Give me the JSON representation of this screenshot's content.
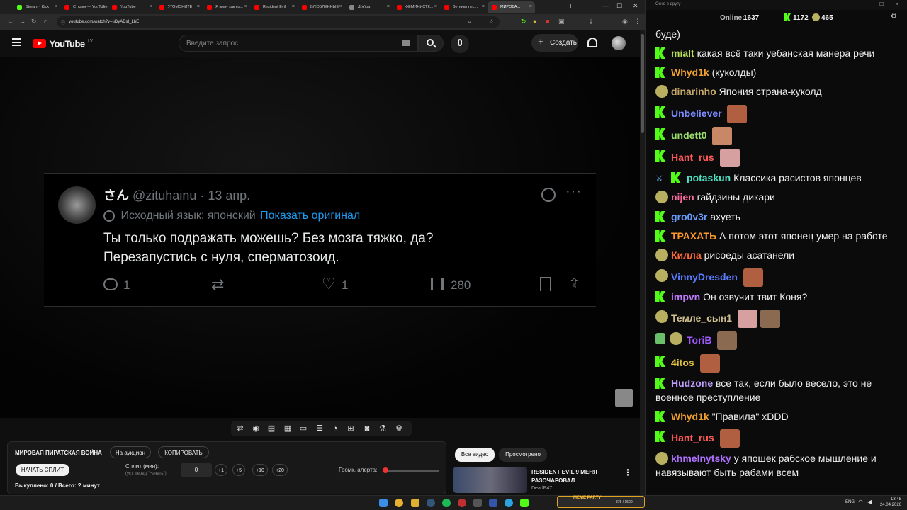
{
  "browser": {
    "tabs": [
      {
        "label": "Stream - Kick",
        "color": "#53fc18"
      },
      {
        "label": "Студия — YouTube",
        "color": "#ff0000"
      },
      {
        "label": "YouTube",
        "color": "#ff0000"
      },
      {
        "label": "УГОМОНИТЕ",
        "color": "#ff0000"
      },
      {
        "label": "Я живу как ко...",
        "color": "#ff0000"
      },
      {
        "label": "Resident Evil",
        "color": "#ff0000"
      },
      {
        "label": "ВЛЮБЛЕННЫЕ",
        "color": "#ff0000"
      },
      {
        "label": "Д(ж)ра",
        "color": "#888888"
      },
      {
        "label": "ФЕМИНИСТК...",
        "color": "#ff0000"
      },
      {
        "label": "Зетники пес...",
        "color": "#ff0000"
      },
      {
        "label": "МИРОВА...",
        "color": "#ff0000"
      }
    ],
    "url": "youtube.com/watch?v=uDyADsI_LhE"
  },
  "youtube": {
    "logo": "YouTube",
    "region": "LV",
    "search_placeholder": "Введите запрос",
    "create_label": "Создать"
  },
  "tweet": {
    "name": "さん",
    "handle": "@zituhainu · 13 апр.",
    "translated_from": "Исходный язык: японский",
    "show_original": "Показать оригинал",
    "line1": "Ты только подражать можешь? Без мозга тяжко, да?",
    "line2": "Перезапустись с нуля, сперматозоид.",
    "replies": "1",
    "likes": "1",
    "views": "280"
  },
  "ext_panel": {
    "title": "МИРОВАЯ ПИРАТСКАЯ ВОЙНА",
    "on_auction": "На аукцион",
    "copy": "КОПИРОВАТЬ",
    "start_split": "НАЧАТЬ СПЛИТ",
    "split_label": "Сплит (мин):",
    "split_hint": "(уст. перед \"Начать\")",
    "split_value": "0",
    "inc": [
      "+1",
      "+5",
      "+10",
      "+20"
    ],
    "alert_volume": "Громк. алерта:",
    "alert_volume_level": 0.05,
    "bought": "Выкуплено: 0 / Всего: ? минут"
  },
  "suggestions": {
    "tab_all": "Все видео",
    "tab_watched": "Просмотрено",
    "video_title_1": "RESIDENT EVIL 9 МЕНЯ",
    "video_title_2": "РАЗОЧАРОВАЛ",
    "channel": "DeadP47"
  },
  "chat": {
    "window_title": "Окно в другу",
    "online_label": "Online:",
    "online": "1637",
    "kick_count": "1172",
    "other_count": "465",
    "messages": [
      {
        "user": "",
        "text": "буде)",
        "color": "#efefef"
      },
      {
        "user": "mialt",
        "text": "какая всё таки уебанская манера речи",
        "color": "#b8e05c"
      },
      {
        "user": "Whyd1k",
        "text": "(куколды)",
        "color": "#f0a030"
      },
      {
        "user": "dinarinho",
        "text": "Япония страна-куколд",
        "color": "#c6a86a"
      },
      {
        "user": "Unbeliever",
        "text": "",
        "color": "#7a8cff"
      },
      {
        "user": "undett0",
        "text": "",
        "color": "#9be06c"
      },
      {
        "user": "Hant_rus",
        "text": "",
        "color": "#ff5a5a"
      },
      {
        "user": "potaskun",
        "text": "Классика расистов японцев",
        "color": "#4ee0c0"
      },
      {
        "user": "nijen",
        "text": "гайдзины дикари",
        "color": "#ff6aa0"
      },
      {
        "user": "gro0v3r",
        "text": "ахуеть",
        "color": "#6a9cff"
      },
      {
        "user": "ТРАХАТЬ",
        "text": "А потом этот японец умер на работе",
        "color": "#ff9a2a"
      },
      {
        "user": "Килла",
        "text": "рисоеды асатанели",
        "color": "#ff6a3a"
      },
      {
        "user": "VinnyDresden",
        "text": "",
        "color": "#5a7cff"
      },
      {
        "user": "impvn",
        "text": "Он озвучит твит Коня?",
        "color": "#c07aff"
      },
      {
        "user": "Темле_сын1",
        "text": "",
        "color": "#d0c090"
      },
      {
        "user": "ToriB",
        "text": "",
        "color": "#a05aff"
      },
      {
        "user": "4itos",
        "text": "",
        "color": "#e0c040"
      },
      {
        "user": "Hudzone",
        "text": "все так, если было весело, это не",
        "color": "#c0a0ff"
      },
      {
        "user": "",
        "text": "военное преступление",
        "color": "#efefef"
      },
      {
        "user": "Whyd1k",
        "text": "\"Правила\" xDDD",
        "color": "#f0a030"
      },
      {
        "user": "Hant_rus",
        "text": "",
        "color": "#ff5a5a"
      },
      {
        "user": "khmelnytsky",
        "text": "у япошек рабское мышление и",
        "color": "#b070ff"
      },
      {
        "user": "",
        "text": "навязывают быть рабами всем",
        "color": "#efefef"
      }
    ]
  },
  "taskbar": {
    "meme_title": "MEME PARTY",
    "meme_info": "875 / 1500",
    "lang": "ENG",
    "time": "13:48",
    "date": "24.04.2026"
  }
}
